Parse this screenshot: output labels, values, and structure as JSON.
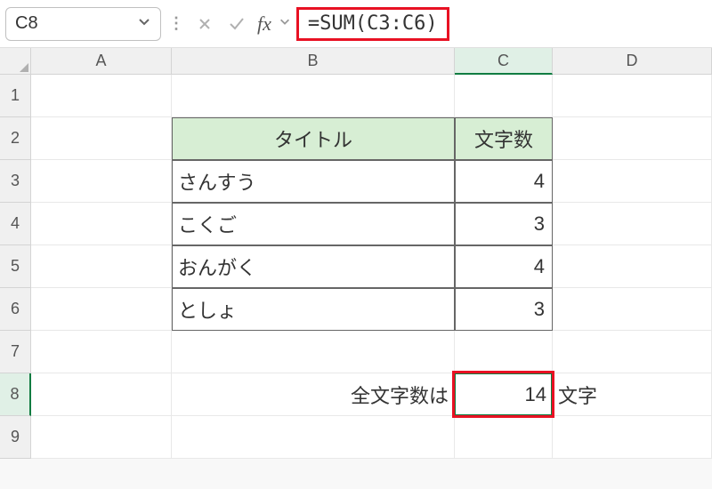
{
  "name_box": "C8",
  "formula": "=SUM(C3:C6)",
  "columns": [
    "A",
    "B",
    "C",
    "D"
  ],
  "rows": [
    1,
    2,
    3,
    4,
    5,
    6,
    7,
    8,
    9
  ],
  "selected_col": "C",
  "selected_row": 8,
  "table": {
    "headers": {
      "title": "タイトル",
      "count": "文字数"
    },
    "data": [
      {
        "title": "さんすう",
        "count": 4
      },
      {
        "title": "こくご",
        "count": 3
      },
      {
        "title": "おんがく",
        "count": 4
      },
      {
        "title": "としょ",
        "count": 3
      }
    ]
  },
  "total_label_prefix": "全文字数は",
  "total_value": 14,
  "total_suffix": "文字"
}
